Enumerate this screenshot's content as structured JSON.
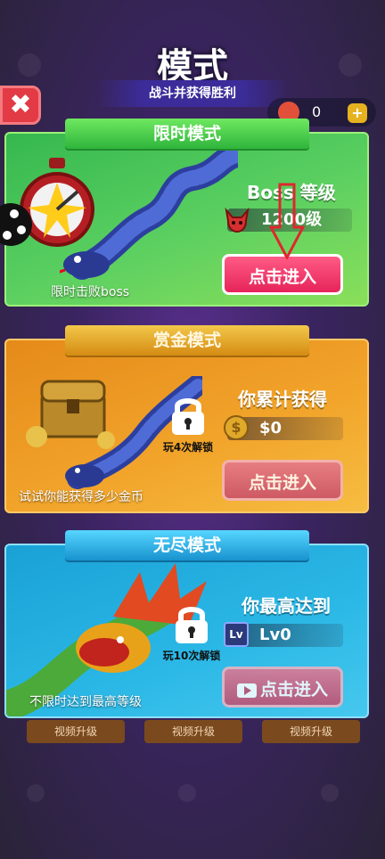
{
  "header": {
    "title": "模式",
    "subtitle": "战斗并获得胜利",
    "close_label": "✖",
    "coin_count": "0",
    "plus_label": "+"
  },
  "cards": {
    "timed": {
      "banner": "限时模式",
      "info_label": "Boss 等级",
      "level_value": "1200级",
      "button": "点击进入",
      "caption": "限时击败boss"
    },
    "bounty": {
      "banner": "赏金模式",
      "info_label": "你累计获得",
      "value": "$0",
      "button": "点击进入",
      "caption": "试试你能获得多少金币",
      "lock_text": "玩4次解锁"
    },
    "endless": {
      "banner": "无尽模式",
      "info_label": "你最高达到",
      "value": "Lv0",
      "badge": "Lv",
      "button": "点击进入",
      "caption": "不限时达到最高等级",
      "lock_text": "玩10次解锁"
    }
  },
  "bottom_buttons": [
    "视频升级",
    "视频升级",
    "视频升级"
  ],
  "colors": {
    "green_card": "#5cd061",
    "orange_card": "#f2a52b",
    "blue_card": "#2bb8e6",
    "button_pink": "#e6245a",
    "arrow_red": "#e0262e"
  }
}
